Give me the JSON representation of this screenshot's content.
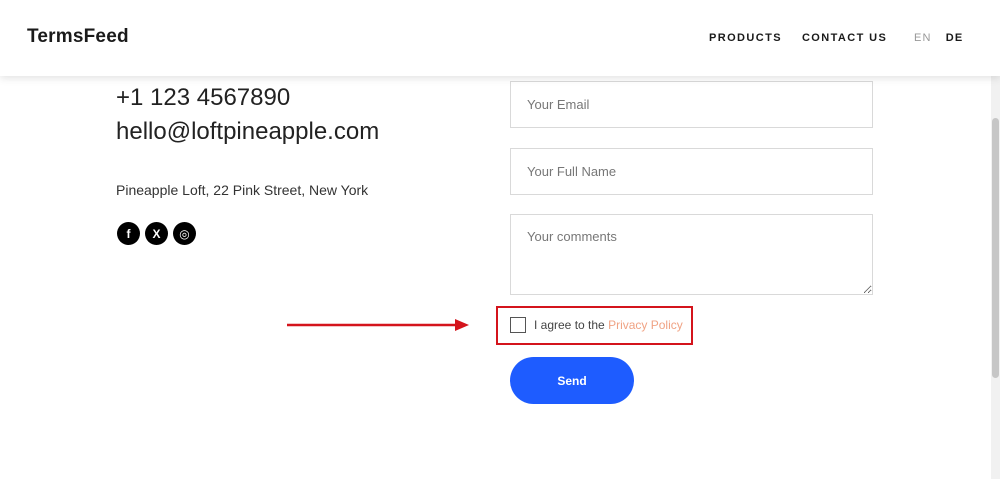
{
  "header": {
    "logo": "TermsFeed",
    "nav": [
      "PRODUCTS",
      "CONTACT US"
    ],
    "lang_en": "EN",
    "lang_de": "DE"
  },
  "contact": {
    "phone": "+1 123 4567890",
    "email": "hello@loftpineapple.com",
    "address": "Pineapple Loft, 22 Pink Street, New York",
    "socials": [
      {
        "icon": "facebook-icon",
        "glyph": "f"
      },
      {
        "icon": "x-icon",
        "glyph": "X"
      },
      {
        "icon": "instagram-icon",
        "glyph": "◎"
      }
    ]
  },
  "form": {
    "email_placeholder": "Your Email",
    "name_placeholder": "Your Full Name",
    "comments_placeholder": "Your comments",
    "agree_prefix": "I agree to the ",
    "privacy_link": "Privacy Policy",
    "send_label": "Send"
  },
  "colors": {
    "accent": "#1e5cff",
    "link": "#f0a384",
    "highlight": "#d4141c"
  }
}
